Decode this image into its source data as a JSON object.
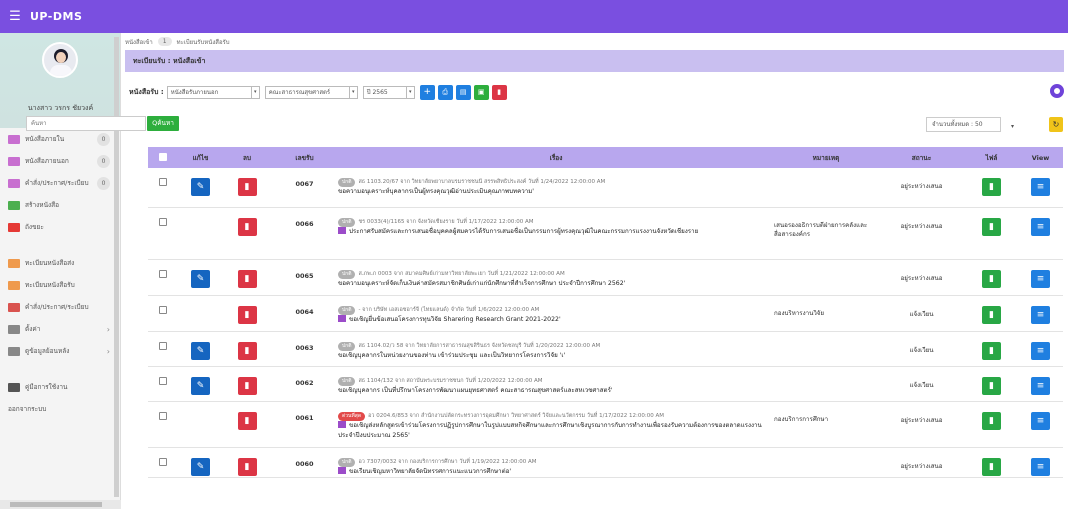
{
  "app": {
    "title": "UP-DMS"
  },
  "colors": {
    "primary": "#7a4fe0",
    "header_bar": "#c9bff0",
    "table_head": "#b8a7ee",
    "edit": "#1565c0",
    "delete": "#dc3545",
    "file": "#28a745",
    "view": "#1f7fe0"
  },
  "user": {
    "name": "นางสาว วรกร ชัยวงค์"
  },
  "sidebar": {
    "items": [
      {
        "label": "หนังสือภายใน",
        "count": "0",
        "icon_color": "#c86fd0"
      },
      {
        "label": "หนังสือภายนอก",
        "count": "0",
        "icon_color": "#c86fd0"
      },
      {
        "label": "คำสั่ง/ประกาศ/ระเบียบ",
        "count": "0",
        "icon_color": "#c86fd0"
      },
      {
        "label": "สร้างหนังสือ",
        "count": "",
        "icon_color": "#4caf50"
      },
      {
        "label": "ถังขยะ",
        "count": "",
        "icon_color": "#e53935"
      },
      {
        "label": "ทะเบียนหนังสือส่ง",
        "count": "",
        "icon_color": "#ef9a4d"
      },
      {
        "label": "ทะเบียนหนังสือรับ",
        "count": "",
        "icon_color": "#ef9a4d"
      },
      {
        "label": "คำสั่ง/ประกาศ/ระเบียบ",
        "count": "",
        "icon_color": "#d9534f"
      },
      {
        "label": "ตั้งค่า",
        "count": "",
        "icon_color": "#888888"
      },
      {
        "label": "ดูข้อมูลย้อนหลัง",
        "count": "",
        "icon_color": "#888888"
      },
      {
        "label": "คู่มือการใช้งาน",
        "count": "",
        "icon_color": "#555555"
      },
      {
        "label": "ออกจากระบบ",
        "count": "",
        "icon_color": ""
      }
    ]
  },
  "breadcrumb": {
    "home": "หนังสือเข้า",
    "count": "1",
    "current": "ทะเบียนรับหนังสือรับ"
  },
  "page": {
    "title": "ทะเบียนรับ : หนังสือเข้า"
  },
  "filters": {
    "label": "หนังสือรับ :",
    "type": "หนังสือรับภายนอก",
    "faculty": "คณะสาธารณสุขศาสตร์",
    "year": "ปี 2565"
  },
  "search": {
    "placeholder": "ค้นหา",
    "button": "Qค้นหา"
  },
  "total": {
    "label": "จำนวนทั้งหมด : 50"
  },
  "table": {
    "headers": {
      "edit": "แก้ไข",
      "del": "ลบ",
      "no": "เลขรับ",
      "subject": "เรื่อง",
      "note": "หมายเหตุ",
      "status": "สถานะ",
      "file": "ไฟล์",
      "view": "View"
    },
    "rows": [
      {
        "no": "0067",
        "badge": "ปกติ",
        "badge_red": false,
        "meta": "สธ 1103.20/67 จาก วิทยาลัยพยาบาลบรมราชชนนี สรรพสิทธิประสงค์ วันที่ 1/24/2022 12:00:00 AM",
        "subject": "ขอความอนุเคราะห์บุคลากรเป็นผู้ทรงคุณวุฒิอ่านประเมินคุณภาพบทความ'",
        "doc": false,
        "note": "",
        "status": "อยู่ระหว่างเสนอ",
        "editable": true,
        "height": 40
      },
      {
        "no": "0066",
        "badge": "ปกติ",
        "badge_red": false,
        "meta": "ชร 0033(4)/1165 จาก จังหวัดเชียงราย วันที่ 1/17/2022 12:00:00 AM",
        "subject": "ประกาศรับสมัครและการเสนอชื่อบุคคลผู้สมควรได้รับการเสนอชื่อเป็นกรรมการผู้ทรงคุณวุฒิในคณะกรรมการแรงงานจังหวัดเชียงราย",
        "doc": true,
        "note": "เสนอรองอธิการบดีฝ่ายการคลังและสื่อสารองค์กร",
        "status": "อยู่ระหว่างเสนอ",
        "editable": false,
        "height": 52
      },
      {
        "no": "0065",
        "badge": "ปกติ",
        "badge_red": false,
        "meta": "ส.ภพ.ภ 0003 จาก สมาคมศิษย์เก่ามหาวิทยาลัยพะเยา วันที่ 1/21/2022 12:00:00 AM",
        "subject": "ขอความอนุเคราะห์จัดเก็บเงินค่าสมัครสมาชิกศิษย์เก่าแก่นักศึกษาที่สำเร็จการศึกษา ประจำปีการศึกษา 2562'",
        "doc": false,
        "note": "",
        "status": "อยู่ระหว่างเสนอ",
        "editable": true,
        "height": 36
      },
      {
        "no": "0064",
        "badge": "ปกติ",
        "badge_red": false,
        "meta": "- จาก บริษัท เอสเอชอาร์จี (ไทยแลนด์) จำกัด วันที่ 1/6/2022 12:00:00 AM",
        "subject": "ขอเชิญยื่นข้อเสนอโครงการทุนวิจัย Sharering Research Grant 2021-2022'",
        "doc": true,
        "note": "กองบริหารงานวิจัย",
        "status": "แจ้งเวียน",
        "editable": false,
        "height": 36
      },
      {
        "no": "0063",
        "badge": "ปกติ",
        "badge_red": false,
        "meta": "สธ 1104.02/ว 58 จาก วิทยาลัยการสาธารณสุขสิรินธร จังหวัดชลบุรี วันที่ 1/20/2022 12:00:00 AM",
        "subject": "ขอเชิญบุคลากรในหน่วยงานของท่าน เข้าร่วมประชุม และเป็นวิทยากรโครงการวิจัย 'เ'",
        "doc": false,
        "note": "",
        "status": "แจ้งเวียน",
        "editable": true,
        "height": 35
      },
      {
        "no": "0062",
        "badge": "ปกติ",
        "badge_red": false,
        "meta": "สธ 1104/132 จาก สถาบันพระบรมราชชนก วันที่ 1/20/2022 12:00:00 AM",
        "subject": "ขอเชิญบุคลากร เป็นที่ปรึกษาโครงการพัฒนาแผนยุทธศาสตร์ คณะสาธารณสุขศาสตร์และสหเวชศาสตร์'",
        "doc": false,
        "note": "",
        "status": "แจ้งเวียน",
        "editable": true,
        "height": 35
      },
      {
        "no": "0061",
        "badge": "ด่วนที่สุด",
        "badge_red": true,
        "meta": "อว 0204.6/853 จาก สำนักงานปลัดกระทรวงการอุดมศึกษา วิทยาศาสตร์ วิจัยและนวัตกรรม วันที่ 1/17/2022 12:00:00 AM",
        "subject": "ขอเชิญส่งหลักสูตรเข้าร่วมโครงการปฏิรูปการศึกษาในรูปแบบสหกิจศึกษาและการศึกษาเชิงบูรณาการกับการทำงานเพื่อรองรับความต้องการของตลาดแรงงาน ประจำปีงบประมาณ 2565'",
        "doc": true,
        "note": "กองบริการการศึกษา",
        "status": "อยู่ระหว่างเสนอ",
        "editable": false,
        "height": 46
      },
      {
        "no": "0060",
        "badge": "ปกติ",
        "badge_red": false,
        "meta": "อว 7307/0032 จาก กองบริการการศึกษา วันที่ 1/19/2022 12:00:00 AM",
        "subject": "ขอเรียนเชิญมหาวิทยาลัยจัดนิทรรศการแนะแนวการศึกษาต่อ'",
        "doc": true,
        "note": "",
        "status": "อยู่ระหว่างเสนอ",
        "editable": true,
        "height": 30
      }
    ]
  }
}
